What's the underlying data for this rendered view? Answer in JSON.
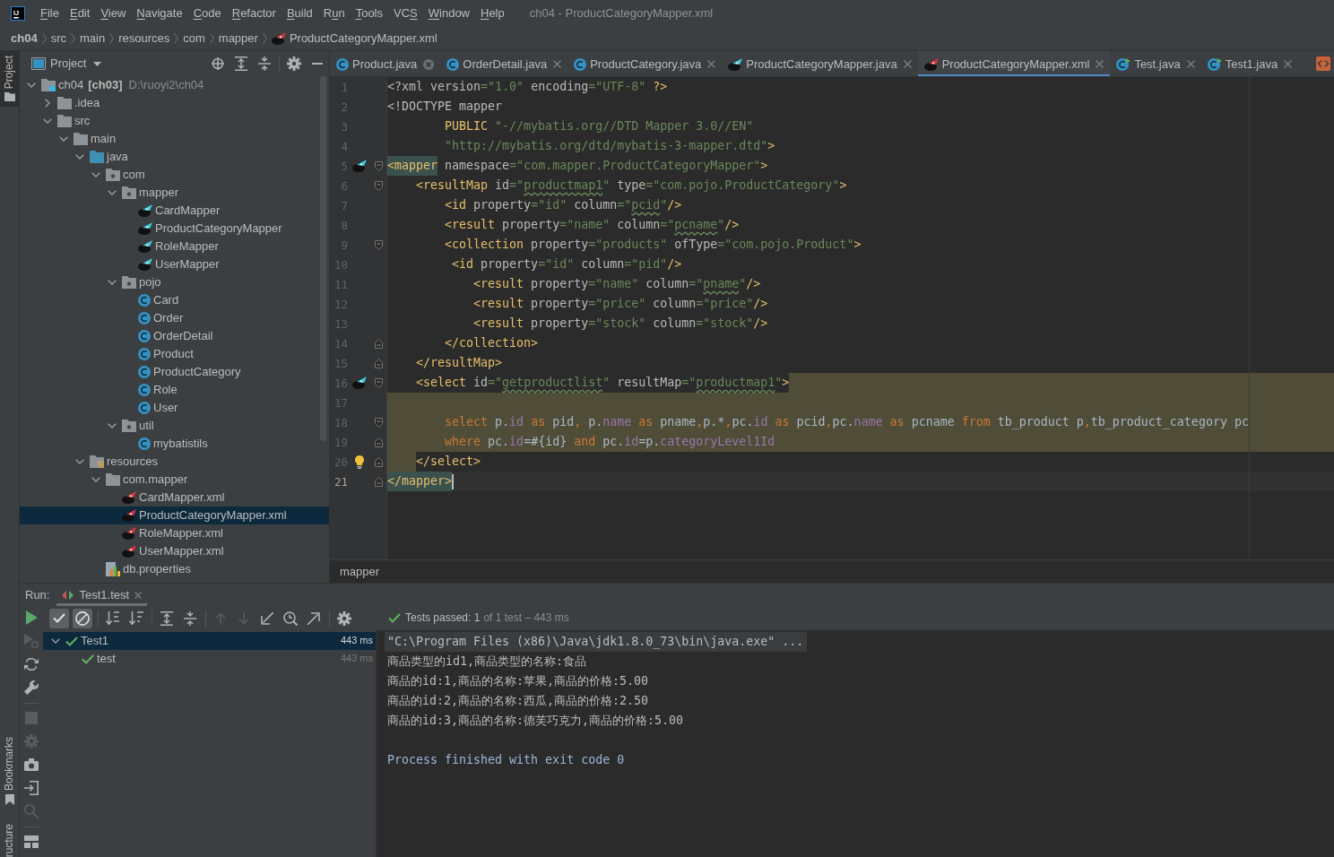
{
  "window": {
    "logo": "IJ",
    "title": "ch04 - ProductCategoryMapper.xml"
  },
  "menu": [
    {
      "label": "File",
      "mnemonic": {
        "kind": "first"
      }
    },
    {
      "label": "Edit",
      "mnemonic": {
        "kind": "first"
      }
    },
    {
      "label": "View",
      "mnemonic": {
        "kind": "first"
      }
    },
    {
      "label": "Navigate",
      "mnemonic": {
        "kind": "first"
      }
    },
    {
      "label": "Code",
      "mnemonic": {
        "kind": "first"
      }
    },
    {
      "label": "Refactor",
      "mnemonic": {
        "kind": "first"
      }
    },
    {
      "label": "Build",
      "mnemonic": {
        "kind": "first"
      }
    },
    {
      "label": "Run",
      "mnemonic": {
        "kind": "second"
      }
    },
    {
      "label": "Tools",
      "mnemonic": {
        "kind": "first"
      }
    },
    {
      "label": "VCS",
      "mnemonic": {
        "kind": "third"
      }
    },
    {
      "label": "Window",
      "mnemonic": {
        "kind": "first"
      }
    },
    {
      "label": "Help",
      "mnemonic": {
        "kind": "first"
      }
    }
  ],
  "breadcrumbs": [
    {
      "label": "ch04",
      "kind": "project"
    },
    {
      "label": "src",
      "kind": "dir"
    },
    {
      "label": "main",
      "kind": "dir"
    },
    {
      "label": "resources",
      "kind": "dir"
    },
    {
      "label": "com",
      "kind": "dir"
    },
    {
      "label": "mapper",
      "kind": "dir"
    },
    {
      "label": "ProductCategoryMapper.xml",
      "kind": "xml"
    }
  ],
  "tool_stripe": {
    "top": [
      {
        "label": "Project",
        "kind": "project",
        "selected": true
      }
    ],
    "bottom": [
      {
        "label": "Bookmarks",
        "kind": "bookmarks",
        "selected": false
      },
      {
        "label": "ructure",
        "kind": "structure",
        "selected": false
      }
    ]
  },
  "project": {
    "title": "Project",
    "tree": [
      {
        "label": "ch04",
        "tag": "[ch03]",
        "path": "D:\\ruoyi2\\ch04",
        "kind": "module",
        "expanded": true,
        "selected": false,
        "children": [
          {
            "label": ".idea",
            "kind": "folder",
            "expanded": false,
            "selected": false
          },
          {
            "label": "src",
            "kind": "folder",
            "expanded": true,
            "selected": false,
            "children": [
              {
                "label": "main",
                "kind": "folder",
                "expanded": true,
                "selected": false,
                "children": [
                  {
                    "label": "java",
                    "kind": "source",
                    "expanded": true,
                    "selected": false,
                    "children": [
                      {
                        "label": "com",
                        "kind": "package",
                        "expanded": true,
                        "selected": false,
                        "children": [
                          {
                            "label": "mapper",
                            "kind": "package",
                            "expanded": true,
                            "selected": false,
                            "children": [
                              {
                                "label": "CardMapper",
                                "kind": "mapper",
                                "selected": false
                              },
                              {
                                "label": "ProductCategoryMapper",
                                "kind": "mapper",
                                "selected": false
                              },
                              {
                                "label": "RoleMapper",
                                "kind": "mapper",
                                "selected": false
                              },
                              {
                                "label": "UserMapper",
                                "kind": "mapper",
                                "selected": false
                              }
                            ]
                          },
                          {
                            "label": "pojo",
                            "kind": "package",
                            "expanded": true,
                            "selected": false,
                            "children": [
                              {
                                "label": "Card",
                                "kind": "class",
                                "selected": false
                              },
                              {
                                "label": "Order",
                                "kind": "class",
                                "selected": false
                              },
                              {
                                "label": "OrderDetail",
                                "kind": "class",
                                "selected": false
                              },
                              {
                                "label": "Product",
                                "kind": "class",
                                "selected": false
                              },
                              {
                                "label": "ProductCategory",
                                "kind": "class",
                                "selected": false
                              },
                              {
                                "label": "Role",
                                "kind": "class",
                                "selected": false
                              },
                              {
                                "label": "User",
                                "kind": "class",
                                "selected": false
                              }
                            ]
                          },
                          {
                            "label": "util",
                            "kind": "package",
                            "expanded": true,
                            "selected": false,
                            "children": [
                              {
                                "label": "mybatistils",
                                "kind": "class",
                                "selected": false
                              }
                            ]
                          }
                        ]
                      }
                    ]
                  },
                  {
                    "label": "resources",
                    "kind": "resources",
                    "expanded": true,
                    "selected": false,
                    "children": [
                      {
                        "label": "com.mapper",
                        "kind": "folder",
                        "expanded": true,
                        "selected": false,
                        "children": [
                          {
                            "label": "CardMapper.xml",
                            "kind": "xml",
                            "selected": false
                          },
                          {
                            "label": "ProductCategoryMapper.xml",
                            "kind": "xml",
                            "selected": true
                          },
                          {
                            "label": "RoleMapper.xml",
                            "kind": "xml",
                            "selected": false
                          },
                          {
                            "label": "UserMapper.xml",
                            "kind": "xml",
                            "selected": false
                          }
                        ]
                      },
                      {
                        "label": "db.properties",
                        "kind": "properties",
                        "selected": false
                      }
                    ]
                  }
                ]
              }
            ]
          }
        ]
      }
    ]
  },
  "editor": {
    "tabs": [
      {
        "label": "Product.java",
        "kind": "class",
        "selected": false,
        "hovered": true
      },
      {
        "label": "OrderDetail.java",
        "kind": "class",
        "selected": false,
        "hovered": false
      },
      {
        "label": "ProductCategory.java",
        "kind": "class",
        "selected": false,
        "hovered": false
      },
      {
        "label": "ProductCategoryMapper.java",
        "kind": "mapper",
        "selected": false,
        "hovered": false
      },
      {
        "label": "ProductCategoryMapper.xml",
        "kind": "xml",
        "selected": true,
        "hovered": false
      },
      {
        "label": "Test.java",
        "kind": "test",
        "selected": false,
        "hovered": false
      },
      {
        "label": "Test1.java",
        "kind": "test",
        "selected": false,
        "hovered": false
      }
    ],
    "lines": [
      {
        "number": "1",
        "caret": false,
        "tokens": [
          {
            "text": "<?xml version",
            "kind": "attr"
          },
          {
            "text": "=\"1.0\"",
            "kind": "value"
          },
          {
            "text": " encoding",
            "kind": "attr"
          },
          {
            "text": "=\"UTF-8\"",
            "kind": "value"
          },
          {
            "text": " ?>",
            "kind": "tag"
          }
        ]
      },
      {
        "number": "2",
        "caret": false,
        "tokens": [
          {
            "text": "<!DOCTYPE mapper",
            "kind": "attr"
          }
        ]
      },
      {
        "number": "3",
        "caret": false,
        "tokens": [
          {
            "text": "        PUBLIC",
            "kind": "tag"
          },
          {
            "text": " \"-//mybatis.org//DTD Mapper 3.0//EN\"",
            "kind": "value"
          }
        ]
      },
      {
        "number": "4",
        "caret": false,
        "tokens": [
          {
            "text": "        \"http://mybatis.org/dtd/mybatis-3-mapper.dtd\"",
            "kind": "value"
          },
          {
            "text": ">",
            "kind": "tag"
          }
        ]
      },
      {
        "number": "5",
        "caret": false,
        "marker": {
          "kind": "bird"
        },
        "fold": {
          "kind": "open"
        },
        "tokens": [
          {
            "text": "<mapper",
            "kind": "match"
          },
          {
            "text": " namespace",
            "kind": "attr"
          },
          {
            "text": "=\"com.mapper.ProductCategoryMapper\"",
            "kind": "value"
          },
          {
            "text": ">",
            "kind": "tag"
          }
        ]
      },
      {
        "number": "6",
        "caret": false,
        "fold": {
          "kind": "open"
        },
        "tokens": [
          {
            "text": "    <resultMap",
            "kind": "tag"
          },
          {
            "text": " id",
            "kind": "attr"
          },
          {
            "text": "=\"",
            "kind": "value"
          },
          {
            "text": "productmap1",
            "kind": "typo"
          },
          {
            "text": "\"",
            "kind": "value"
          },
          {
            "text": " type",
            "kind": "attr"
          },
          {
            "text": "=\"com.pojo.ProductCategory\"",
            "kind": "value"
          },
          {
            "text": ">",
            "kind": "tag"
          }
        ]
      },
      {
        "number": "7",
        "caret": false,
        "tokens": [
          {
            "text": "        <id",
            "kind": "tag"
          },
          {
            "text": " property",
            "kind": "attr"
          },
          {
            "text": "=\"id\"",
            "kind": "value"
          },
          {
            "text": " column",
            "kind": "attr"
          },
          {
            "text": "=\"",
            "kind": "value"
          },
          {
            "text": "pcid",
            "kind": "typo"
          },
          {
            "text": "\"",
            "kind": "value"
          },
          {
            "text": "/>",
            "kind": "tag"
          }
        ]
      },
      {
        "number": "8",
        "caret": false,
        "tokens": [
          {
            "text": "        <result",
            "kind": "tag"
          },
          {
            "text": " property",
            "kind": "attr"
          },
          {
            "text": "=\"name\"",
            "kind": "value"
          },
          {
            "text": " column",
            "kind": "attr"
          },
          {
            "text": "=\"",
            "kind": "value"
          },
          {
            "text": "pcname",
            "kind": "typo"
          },
          {
            "text": "\"",
            "kind": "value"
          },
          {
            "text": "/>",
            "kind": "tag"
          }
        ]
      },
      {
        "number": "9",
        "caret": false,
        "fold": {
          "kind": "open"
        },
        "tokens": [
          {
            "text": "        <collection",
            "kind": "tag"
          },
          {
            "text": " property",
            "kind": "attr"
          },
          {
            "text": "=\"products\"",
            "kind": "value"
          },
          {
            "text": " ofType",
            "kind": "attr"
          },
          {
            "text": "=\"com.pojo.Product\"",
            "kind": "value"
          },
          {
            "text": ">",
            "kind": "tag"
          }
        ]
      },
      {
        "number": "10",
        "caret": false,
        "tokens": [
          {
            "text": "         <id",
            "kind": "tag"
          },
          {
            "text": " property",
            "kind": "attr"
          },
          {
            "text": "=\"id\"",
            "kind": "value"
          },
          {
            "text": " column",
            "kind": "attr"
          },
          {
            "text": "=\"pid\"",
            "kind": "value"
          },
          {
            "text": "/>",
            "kind": "tag"
          }
        ]
      },
      {
        "number": "11",
        "caret": false,
        "tokens": [
          {
            "text": "            <result",
            "kind": "tag"
          },
          {
            "text": " property",
            "kind": "attr"
          },
          {
            "text": "=\"name\"",
            "kind": "value"
          },
          {
            "text": " column",
            "kind": "attr"
          },
          {
            "text": "=\"",
            "kind": "value"
          },
          {
            "text": "pname",
            "kind": "typo"
          },
          {
            "text": "\"",
            "kind": "value"
          },
          {
            "text": "/>",
            "kind": "tag"
          }
        ]
      },
      {
        "number": "12",
        "caret": false,
        "tokens": [
          {
            "text": "            <result",
            "kind": "tag"
          },
          {
            "text": " property",
            "kind": "attr"
          },
          {
            "text": "=\"price\"",
            "kind": "value"
          },
          {
            "text": " column",
            "kind": "attr"
          },
          {
            "text": "=\"price\"",
            "kind": "value"
          },
          {
            "text": "/>",
            "kind": "tag"
          }
        ]
      },
      {
        "number": "13",
        "caret": false,
        "tokens": [
          {
            "text": "            <result",
            "kind": "tag"
          },
          {
            "text": " property",
            "kind": "attr"
          },
          {
            "text": "=\"stock\"",
            "kind": "value"
          },
          {
            "text": " column",
            "kind": "attr"
          },
          {
            "text": "=\"stock\"",
            "kind": "value"
          },
          {
            "text": "/>",
            "kind": "tag"
          }
        ]
      },
      {
        "number": "14",
        "caret": false,
        "fold": {
          "kind": "close"
        },
        "tokens": [
          {
            "text": "        </collection>",
            "kind": "tag"
          }
        ]
      },
      {
        "number": "15",
        "caret": false,
        "fold": {
          "kind": "close"
        },
        "tokens": [
          {
            "text": "    </resultMap>",
            "kind": "tag"
          }
        ]
      },
      {
        "number": "16",
        "caret": false,
        "marker": {
          "kind": "bird"
        },
        "fold": {
          "kind": "open"
        },
        "region": {
          "kind": "tail"
        },
        "tokens": [
          {
            "text": "    <select",
            "kind": "tag"
          },
          {
            "text": " id",
            "kind": "attr"
          },
          {
            "text": "=\"",
            "kind": "value"
          },
          {
            "text": "getproductlist",
            "kind": "typo"
          },
          {
            "text": "\"",
            "kind": "value"
          },
          {
            "text": " resultMap",
            "kind": "attr"
          },
          {
            "text": "=\"",
            "kind": "value"
          },
          {
            "text": "productmap1",
            "kind": "typo"
          },
          {
            "text": "\"",
            "kind": "value"
          },
          {
            "text": ">",
            "kind": "tag"
          }
        ]
      },
      {
        "number": "17",
        "caret": false,
        "region": {
          "kind": "full"
        }
      },
      {
        "number": "18",
        "caret": false,
        "fold": {
          "kind": "open"
        },
        "region": {
          "kind": "full"
        },
        "tokens": [
          {
            "text": "        select",
            "kind": "keyword"
          },
          {
            "text": " p.",
            "kind": "plain"
          },
          {
            "text": "id",
            "kind": "column"
          },
          {
            "text": " as",
            "kind": "keyword"
          },
          {
            "text": " pid",
            "kind": "plain"
          },
          {
            "text": ",",
            "kind": "keyword"
          },
          {
            "text": " p.",
            "kind": "plain"
          },
          {
            "text": "name",
            "kind": "column"
          },
          {
            "text": " as",
            "kind": "keyword"
          },
          {
            "text": " pname",
            "kind": "plain"
          },
          {
            "text": ",",
            "kind": "keyword"
          },
          {
            "text": "p.*",
            "kind": "plain"
          },
          {
            "text": ",",
            "kind": "keyword"
          },
          {
            "text": "pc.",
            "kind": "plain"
          },
          {
            "text": "id",
            "kind": "column"
          },
          {
            "text": " as",
            "kind": "keyword"
          },
          {
            "text": " pcid",
            "kind": "plain"
          },
          {
            "text": ",",
            "kind": "keyword"
          },
          {
            "text": "pc.",
            "kind": "plain"
          },
          {
            "text": "name",
            "kind": "column"
          },
          {
            "text": " as",
            "kind": "keyword"
          },
          {
            "text": " pcname",
            "kind": "plain"
          },
          {
            "text": " from",
            "kind": "keyword"
          },
          {
            "text": " tb_product p",
            "kind": "plain"
          },
          {
            "text": ",",
            "kind": "keyword"
          },
          {
            "text": "tb_product_category pc",
            "kind": "plain"
          }
        ]
      },
      {
        "number": "19",
        "caret": false,
        "fold": {
          "kind": "close"
        },
        "region": {
          "kind": "full"
        },
        "tokens": [
          {
            "text": "        where",
            "kind": "keyword"
          },
          {
            "text": " pc.",
            "kind": "plain"
          },
          {
            "text": "id",
            "kind": "column"
          },
          {
            "text": "=#{id}",
            "kind": "plain"
          },
          {
            "text": " and",
            "kind": "keyword"
          },
          {
            "text": " pc.",
            "kind": "plain"
          },
          {
            "text": "id",
            "kind": "column"
          },
          {
            "text": "=p.",
            "kind": "plain"
          },
          {
            "text": "categoryLevel1Id",
            "kind": "column"
          }
        ]
      },
      {
        "number": "20",
        "caret": false,
        "marker": {
          "kind": "bulb"
        },
        "fold": {
          "kind": "close"
        },
        "region": {
          "kind": "head"
        },
        "tokens": [
          {
            "text": "    </select>",
            "kind": "tag"
          }
        ]
      },
      {
        "number": "21",
        "caret": true,
        "fold": {
          "kind": "close"
        },
        "tokens": [
          {
            "text": "</mapper>",
            "kind": "match"
          }
        ]
      }
    ],
    "breadcrumbs": [
      "mapper"
    ]
  },
  "run": {
    "label": "Run:",
    "tabs": [
      {
        "label": "Test1.test",
        "selected": true
      }
    ],
    "side_tools": [
      [
        {
          "kind": "run",
          "disabled": false
        },
        {
          "kind": "rerun-failed",
          "disabled": true
        },
        {
          "kind": "auto-rerun",
          "disabled": false
        },
        {
          "kind": "wrench",
          "disabled": false
        }
      ],
      [
        {
          "kind": "stop",
          "disabled": true
        },
        {
          "kind": "debug",
          "disabled": true
        },
        {
          "kind": "camera",
          "disabled": false
        },
        {
          "kind": "exit",
          "disabled": false
        },
        {
          "kind": "pin",
          "disabled": true
        }
      ],
      [
        {
          "kind": "layout",
          "disabled": false
        }
      ]
    ],
    "toolbar": [
      [
        {
          "kind": "show-passed",
          "toggled": true,
          "disabled": false
        },
        {
          "kind": "show-ignored",
          "toggled": true,
          "disabled": false
        }
      ],
      [
        {
          "kind": "sort-alpha",
          "toggled": false,
          "disabled": false
        },
        {
          "kind": "sort-duration",
          "toggled": false,
          "disabled": false
        }
      ],
      [
        {
          "kind": "expand-all",
          "toggled": false,
          "disabled": false
        },
        {
          "kind": "collapse-all",
          "toggled": false,
          "disabled": false
        }
      ],
      [
        {
          "kind": "previous",
          "toggled": false,
          "disabled": true
        },
        {
          "kind": "next",
          "toggled": false,
          "disabled": true
        },
        {
          "kind": "import",
          "toggled": false,
          "disabled": false
        },
        {
          "kind": "history",
          "toggled": false,
          "disabled": false
        },
        {
          "kind": "export",
          "toggled": false,
          "disabled": false
        }
      ],
      [
        {
          "kind": "settings",
          "toggled": false,
          "disabled": false
        }
      ]
    ],
    "summary": {
      "passed": true,
      "label": "Tests passed: 1",
      "detail": "of 1 test – 443 ms"
    },
    "tests": [
      {
        "label": "Test1",
        "time": "443 ms",
        "passed": true,
        "expanded": true,
        "selected": true,
        "children": [
          {
            "label": "test",
            "time": "443 ms",
            "passed": true,
            "selected": false
          }
        ]
      }
    ],
    "console": [
      {
        "kind": "command",
        "text": "\"C:\\Program Files (x86)\\Java\\jdk1.8.0_73\\bin\\java.exe\" ..."
      },
      {
        "kind": "output",
        "text": "商品类型的id1,商品类型的名称:食品"
      },
      {
        "kind": "output",
        "text": "商品的id:1,商品的名称:苹果,商品的价格:5.00"
      },
      {
        "kind": "output",
        "text": "商品的id:2,商品的名称:西瓜,商品的价格:2.50"
      },
      {
        "kind": "output",
        "text": "商品的id:3,商品的名称:德芙巧克力,商品的价格:5.00"
      },
      {
        "kind": "exit",
        "text": "Process finished with exit code 0"
      }
    ]
  }
}
